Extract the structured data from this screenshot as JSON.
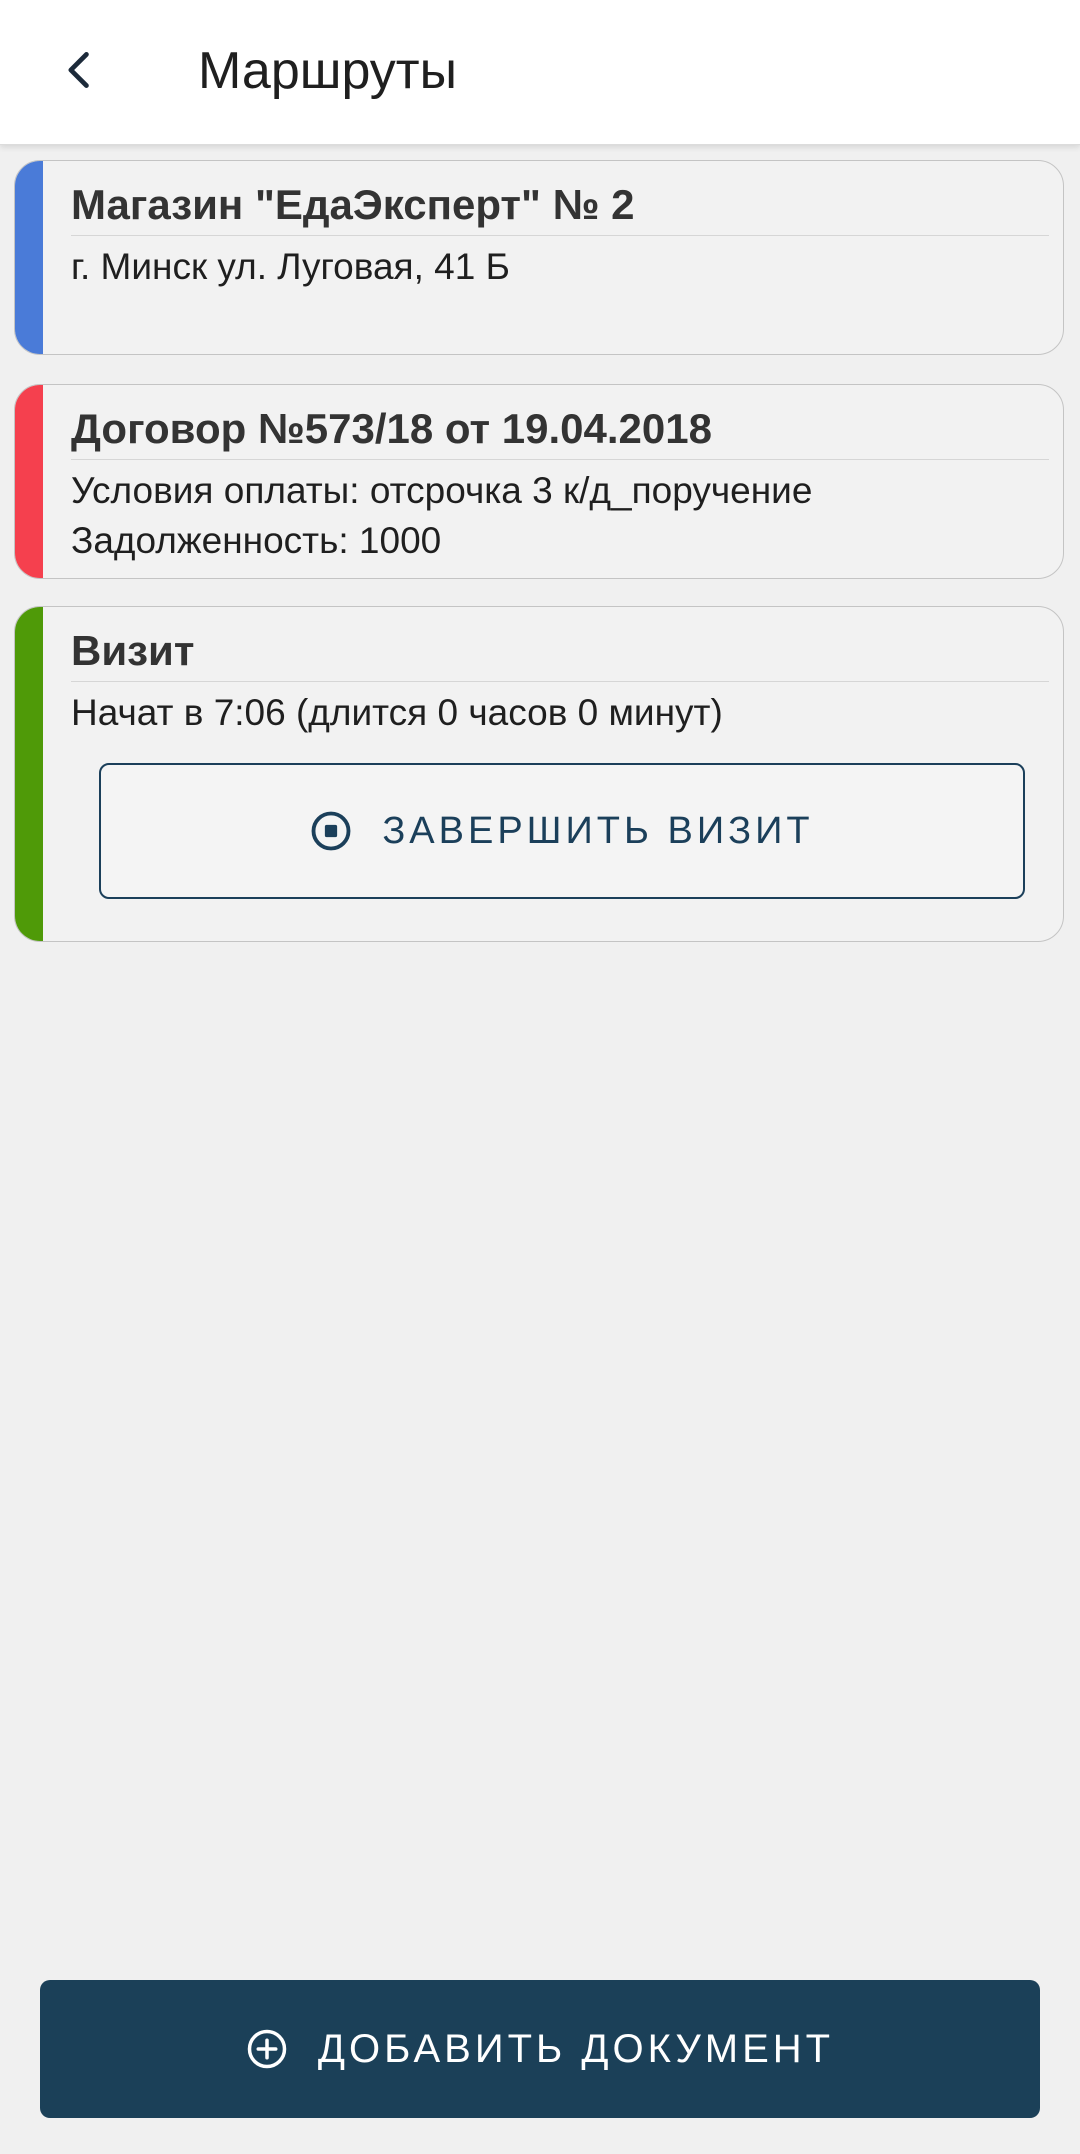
{
  "header": {
    "back_icon": "chevron-left-icon",
    "title": "Маршруты"
  },
  "cards": {
    "store": {
      "accent": "#4a7bd8",
      "title": "Магазин \"ЕдаЭксперт\" № 2",
      "address": "г. Минск ул. Луговая, 41 Б"
    },
    "contract": {
      "accent": "#f5404e",
      "title": "Договор №573/18 от 19.04.2018",
      "payment_terms": "Условия оплаты: отсрочка 3 к/д_поручение",
      "debt": "Задолженность: 1000"
    },
    "visit": {
      "accent": "#4f9a08",
      "title": "Визит",
      "status": "Начат в 7:06 (длится 0 часов 0 минут)",
      "finish_button_label": "ЗАВЕРШИТЬ ВИЗИТ",
      "finish_button_icon": "stop-circle-icon"
    }
  },
  "footer": {
    "add_document_label": "ДОБАВИТЬ ДОКУМЕНТ",
    "add_document_icon": "plus-circle-icon"
  },
  "colors": {
    "primary": "#1b4058",
    "background": "#f0f0f0"
  }
}
